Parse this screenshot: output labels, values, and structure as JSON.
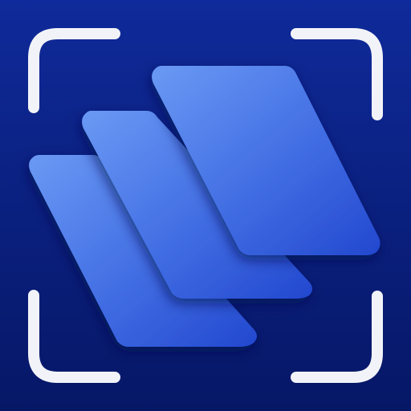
{
  "icon": {
    "name": "scanner-stack-app-icon",
    "colors": {
      "background_top": "#0f2a9a",
      "background_bottom": "#061766",
      "frame_corners": "#f2f3f8",
      "card_light": "#5f8ff0",
      "card_dark": "#2750d4",
      "card_shadow": "#03104d"
    },
    "elements": [
      "scan-frame-corners",
      "document-card-stack"
    ]
  }
}
